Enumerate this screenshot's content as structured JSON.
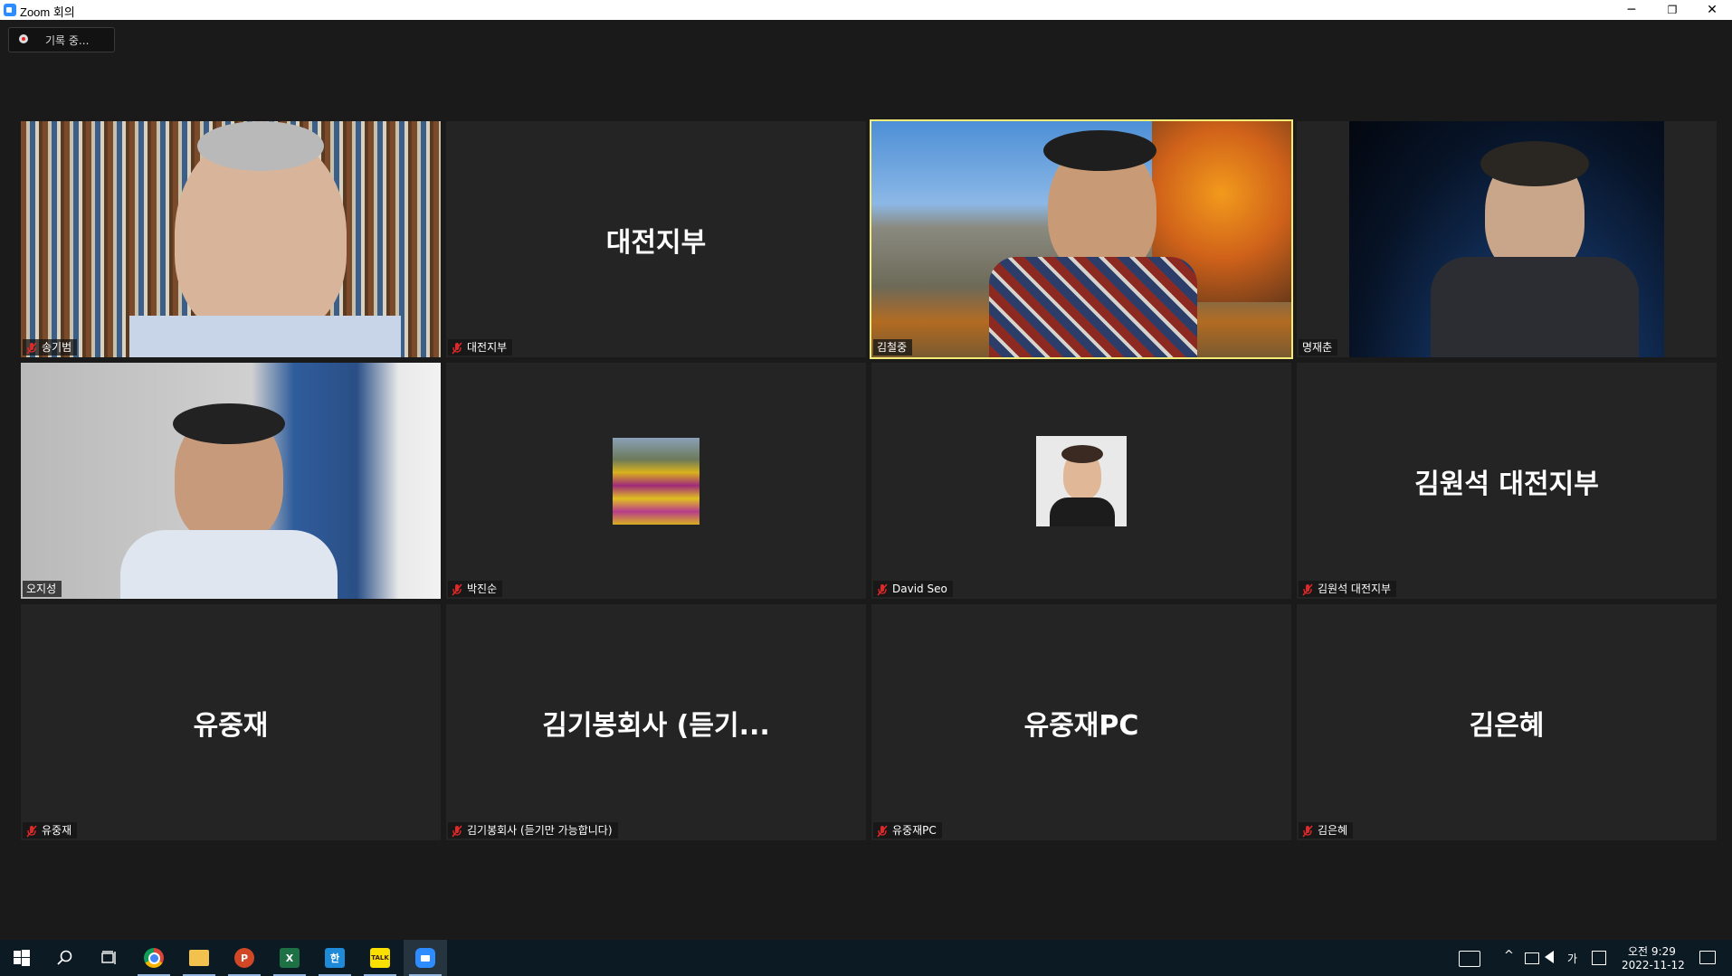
{
  "window": {
    "title": "Zoom 회의",
    "minimize": "─",
    "restore": "❐",
    "close": "✕"
  },
  "recording": {
    "label": "기록 중..."
  },
  "tiles": [
    {
      "display": "",
      "name": "송기범"
    },
    {
      "display": "대전지부",
      "name": "대전지부"
    },
    {
      "display": "",
      "name": "김철중"
    },
    {
      "display": "",
      "name": "명재춘"
    },
    {
      "display": "",
      "name": "오지성"
    },
    {
      "display": "",
      "name": "박진순"
    },
    {
      "display": "",
      "name": "David Seo"
    },
    {
      "display": "김원석 대전지부",
      "name": "김원석 대전지부"
    },
    {
      "display": "유중재",
      "name": "유중재"
    },
    {
      "display": "김기봉회사 (듣기...",
      "name": "김기봉회사 (듣기만 가능합니다)"
    },
    {
      "display": "유중재PC",
      "name": "유중재PC"
    },
    {
      "display": "김은혜",
      "name": "김은혜"
    }
  ],
  "taskbar": {
    "apps": [
      "start-icon",
      "search-icon",
      "task-view-icon",
      "chrome-icon",
      "file-explorer-icon",
      "powerpoint-icon",
      "excel-icon",
      "hangul-icon",
      "kakaotalk-icon",
      "zoom-icon"
    ],
    "ppt_letter": "P",
    "excel_letter": "X",
    "hangul_letter": "한",
    "talk_letter": "TALK",
    "ime": "가",
    "time": "오전 9:29",
    "date": "2022-11-12"
  },
  "colors": {
    "active_speaker": "#f4ec77",
    "mute": "#e02828",
    "tile_bg": "#242424"
  }
}
